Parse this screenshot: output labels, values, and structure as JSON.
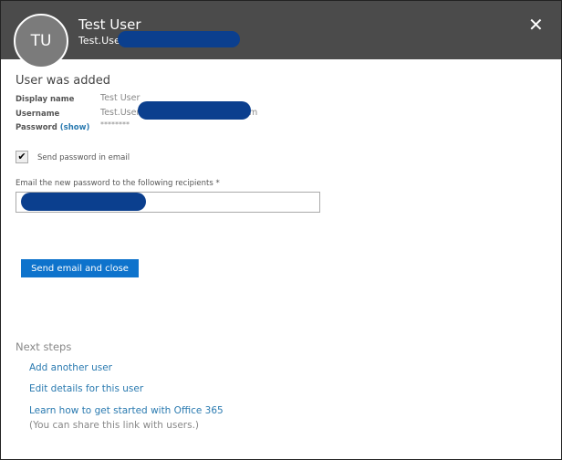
{
  "header": {
    "initials": "TU",
    "name": "Test User",
    "email_prefix": "Test.User",
    "close_icon": "close-icon"
  },
  "title": "User was added",
  "details": {
    "display_name_label": "Display name",
    "display_name": "Test User",
    "username_label": "Username",
    "username_prefix": "Test.User",
    "username_suffix": "m",
    "password_label": "Password",
    "show_link": "(show)",
    "password": "********"
  },
  "send_password_label": "Send password in email",
  "send_password_checked": true,
  "recipients_label": "Email the new password to the following recipients *",
  "send_button": "Send email and close",
  "next_steps": {
    "title": "Next steps",
    "links": [
      "Add another user",
      "Edit details for this user",
      "Learn how to get started with Office 365"
    ],
    "note": "(You can share this link with users.)"
  },
  "colors": {
    "header": "#4b4b4b",
    "accent": "#0e73cc",
    "link": "#2a7ab0",
    "redaction": "#0b3f8e"
  }
}
